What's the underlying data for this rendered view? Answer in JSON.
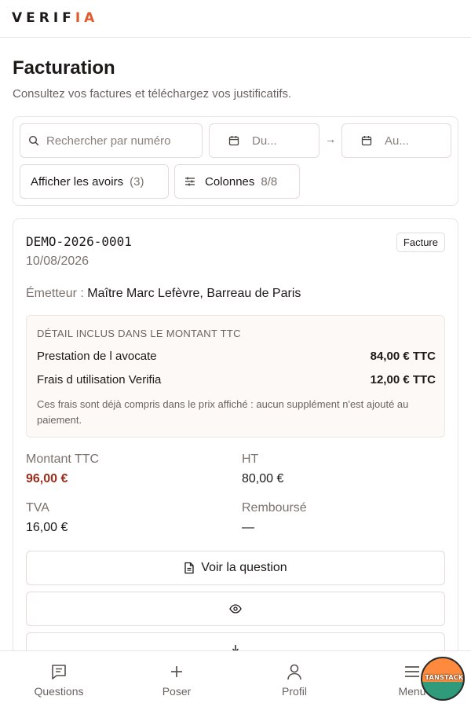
{
  "app": {
    "logo_main": "VERIF",
    "logo_accent": "IA",
    "accent_color": "#e05a2b"
  },
  "page": {
    "title": "Facturation",
    "subtitle": "Consultez vos factures et téléchargez vos justificatifs."
  },
  "filters": {
    "search_placeholder": "Rechercher par numéro",
    "date_from_placeholder": "Du...",
    "date_to_placeholder": "Au...",
    "arrow": "→",
    "show_credits_label": "Afficher les avoirs",
    "show_credits_count": "(3)",
    "columns_label": "Colonnes",
    "columns_count": "8/8"
  },
  "invoice": {
    "number": "DEMO-2026-0001",
    "date": "10/08/2026",
    "type_badge": "Facture",
    "emitter_label": "Émetteur :",
    "emitter_value": "Maître Marc Lefèvre, Barreau de Paris",
    "detail": {
      "title": "DÉTAIL INCLUS DANS LE MONTANT TTC",
      "rows": [
        {
          "label": "Prestation de l avocate",
          "amount": "84,00 € TTC"
        },
        {
          "label": "Frais d utilisation Verifia",
          "amount": "12,00 € TTC"
        }
      ],
      "note": "Ces frais sont déjà compris dans le prix affiché : aucun supplément n'est ajouté au paiement."
    },
    "amounts": {
      "ttc_label": "Montant TTC",
      "ttc_value": "96,00 €",
      "ht_label": "HT",
      "ht_value": "80,00 €",
      "tva_label": "TVA",
      "tva_value": "16,00 €",
      "refunded_label": "Remboursé",
      "refunded_value": "—"
    },
    "actions": {
      "view_question": "Voir la question",
      "preview_icon": "eye-icon",
      "download_icon": "download-icon"
    }
  },
  "bottom_nav": {
    "items": [
      {
        "label": "Questions",
        "icon": "message-square-icon"
      },
      {
        "label": "Poser",
        "icon": "plus-icon"
      },
      {
        "label": "Profil",
        "icon": "user-icon"
      },
      {
        "label": "Menu",
        "icon": "menu-icon"
      }
    ]
  },
  "devtools_badge": "TANSTACK"
}
